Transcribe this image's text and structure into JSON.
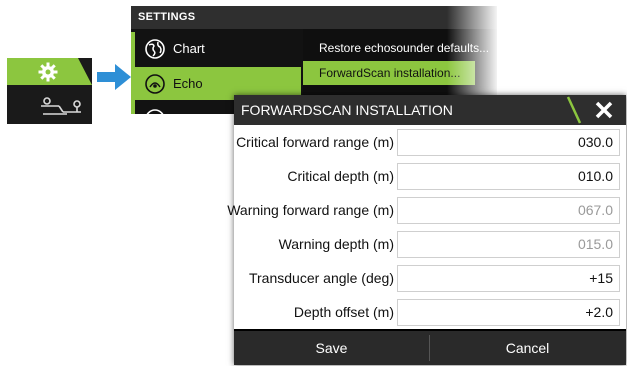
{
  "settings": {
    "header": "SETTINGS",
    "items": [
      {
        "label": "Chart",
        "icon": "globe-icon"
      },
      {
        "label": "Echo",
        "icon": "echo-icon",
        "selected": true
      }
    ],
    "submenu": {
      "items": [
        {
          "label": "Restore echosounder defaults..."
        },
        {
          "label": "ForwardScan installation...",
          "selected": true
        }
      ]
    }
  },
  "dialog": {
    "title": "FORWARDSCAN INSTALLATION",
    "fields": [
      {
        "label": "Critical forward range (m)",
        "value": "030.0",
        "enabled": true
      },
      {
        "label": "Critical depth (m)",
        "value": "010.0",
        "enabled": true
      },
      {
        "label": "Warning forward range (m)",
        "value": "067.0",
        "enabled": false
      },
      {
        "label": "Warning depth (m)",
        "value": "015.0",
        "enabled": false
      },
      {
        "label": "Transducer angle (deg)",
        "value": "+15",
        "enabled": true
      },
      {
        "label": "Depth offset (m)",
        "value": "+2.0",
        "enabled": true
      }
    ],
    "buttons": {
      "save": "Save",
      "cancel": "Cancel"
    }
  },
  "colors": {
    "accent": "#8cc63f",
    "arrow": "#2e8fd6",
    "header": "#2e2e2e"
  }
}
